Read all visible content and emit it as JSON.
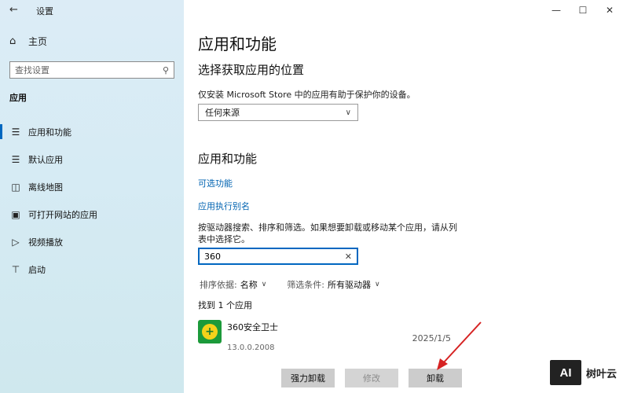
{
  "window": {
    "title": "设置",
    "back_icon": "back-arrow-icon",
    "minimize_glyph": "—",
    "maximize_glyph": "☐",
    "close_glyph": "✕"
  },
  "sidebar": {
    "home_label": "主页",
    "search_placeholder": "查找设置",
    "section_label": "应用",
    "items": [
      {
        "label": "应用和功能",
        "icon": "apps-list-icon",
        "active": true
      },
      {
        "label": "默认应用",
        "icon": "default-apps-icon",
        "active": false
      },
      {
        "label": "离线地图",
        "icon": "offline-map-icon",
        "active": false
      },
      {
        "label": "可打开网站的应用",
        "icon": "web-apps-icon",
        "active": false
      },
      {
        "label": "视频播放",
        "icon": "video-icon",
        "active": false
      },
      {
        "label": "启动",
        "icon": "startup-icon",
        "active": false
      }
    ]
  },
  "main": {
    "page_title": "应用和功能",
    "source_heading": "选择获取应用的位置",
    "source_desc": "仅安装 Microsoft Store 中的应用有助于保护你的设备。",
    "source_value": "任何来源",
    "section_heading": "应用和功能",
    "link_optional": "可选功能",
    "link_alias": "应用执行别名",
    "search_desc": "按驱动器搜索、排序和筛选。如果想要卸载或移动某个应用，请从列表中选择它。",
    "search_value": "360",
    "sort_label": "排序依据:",
    "sort_value": "名称",
    "filter_label": "筛选条件:",
    "filter_value": "所有驱动器",
    "found_text": "找到 1 个应用",
    "app": {
      "name": "360安全卫士",
      "version": "13.0.0.2008",
      "date": "2025/1/5",
      "icon": "360-safe-icon"
    },
    "buttons": {
      "force_uninstall": "强力卸载",
      "modify": "修改",
      "uninstall": "卸载"
    }
  },
  "watermark": {
    "logo": "AI",
    "text": "树叶云"
  },
  "colors": {
    "accent": "#0067c0",
    "link": "#0063b1",
    "annotation_arrow": "#d62222"
  }
}
